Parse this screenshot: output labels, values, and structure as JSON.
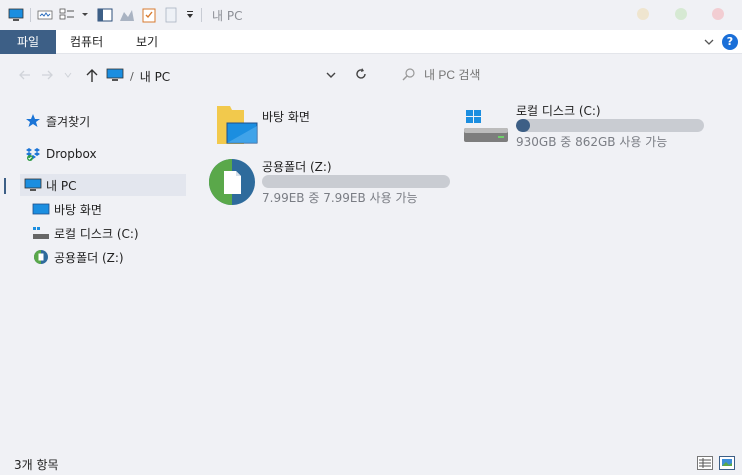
{
  "title": "내 PC",
  "ribbon": {
    "tabs": [
      "파일",
      "컴퓨터",
      "보기"
    ],
    "help_label": "?"
  },
  "nav": {
    "path_sep": "/",
    "path": "내 PC",
    "search_placeholder": "내 PC 검색"
  },
  "sidebar": {
    "items": [
      {
        "label": "즐겨찾기",
        "icon": "star-icon"
      },
      {
        "label": "Dropbox",
        "icon": "dropbox-icon"
      },
      {
        "label": "내 PC",
        "icon": "computer-icon",
        "selected": true
      },
      {
        "label": "바탕 화면",
        "icon": "desktop-icon"
      },
      {
        "label": "로컬 디스크 (C:)",
        "icon": "drive-icon"
      },
      {
        "label": "공용폴더 (Z:)",
        "icon": "shared-drive-icon"
      }
    ]
  },
  "main": {
    "desktop": {
      "name": "바탕 화면"
    },
    "local_disk": {
      "name": "로컬 디스크 (C:)",
      "usage": "930GB 중 862GB 사용 가능",
      "used_fraction": 0.073
    },
    "shared": {
      "name": "공용폴더 (Z:)",
      "usage": "7.99EB 중 7.99EB 사용 가능",
      "used_fraction": 0.0
    }
  },
  "status": {
    "count": "3개 항목"
  },
  "colors": {
    "accent": "#3d5f86",
    "background": "#f0f1f5",
    "bar_track": "#c9ccd2",
    "help": "#1a6fd8"
  }
}
